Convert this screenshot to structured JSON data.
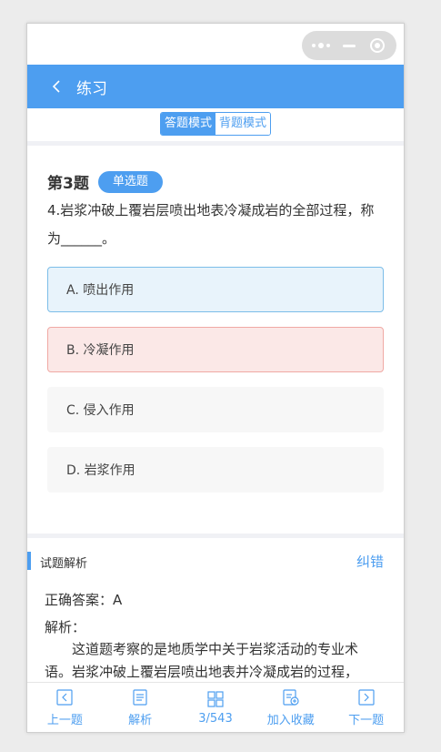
{
  "nav": {
    "back_icon": "chevron-left-icon",
    "title": "练习"
  },
  "modes": [
    {
      "label": "答题模式",
      "active": true
    },
    {
      "label": "背题模式",
      "active": false
    }
  ],
  "question": {
    "number": "第3题",
    "type": "单选题",
    "text": "4.岩浆冲破上覆岩层喷出地表冷凝成岩的全部过程，称为______。"
  },
  "options": [
    {
      "label": "A. 喷出作用",
      "state": "correct"
    },
    {
      "label": "B. 冷凝作用",
      "state": "wrong"
    },
    {
      "label": "C. 侵入作用",
      "state": "plain"
    },
    {
      "label": "D. 岩浆作用",
      "state": "plain"
    }
  ],
  "analysis": {
    "title": "试题解析",
    "correction_link": "纠错",
    "answer_line": "正确答案：A",
    "label": "解析：",
    "text": "这道题考察的是地质学中关于岩浆活动的专业术语。岩浆冲破上覆岩层喷出地表并冷凝成岩的过程，"
  },
  "tabbar": {
    "items": [
      {
        "label": "上一题",
        "icon": "prev-icon"
      },
      {
        "label": "解析",
        "icon": "document-icon"
      },
      {
        "label": "3/543",
        "icon": "grid-icon"
      },
      {
        "label": "加入收藏",
        "icon": "favorite-icon"
      },
      {
        "label": "下一题",
        "icon": "next-icon"
      }
    ]
  },
  "colors": {
    "accent": "#4d9ef0",
    "correct_bg": "#e8f3fb",
    "wrong_bg": "#fbe8e7"
  }
}
